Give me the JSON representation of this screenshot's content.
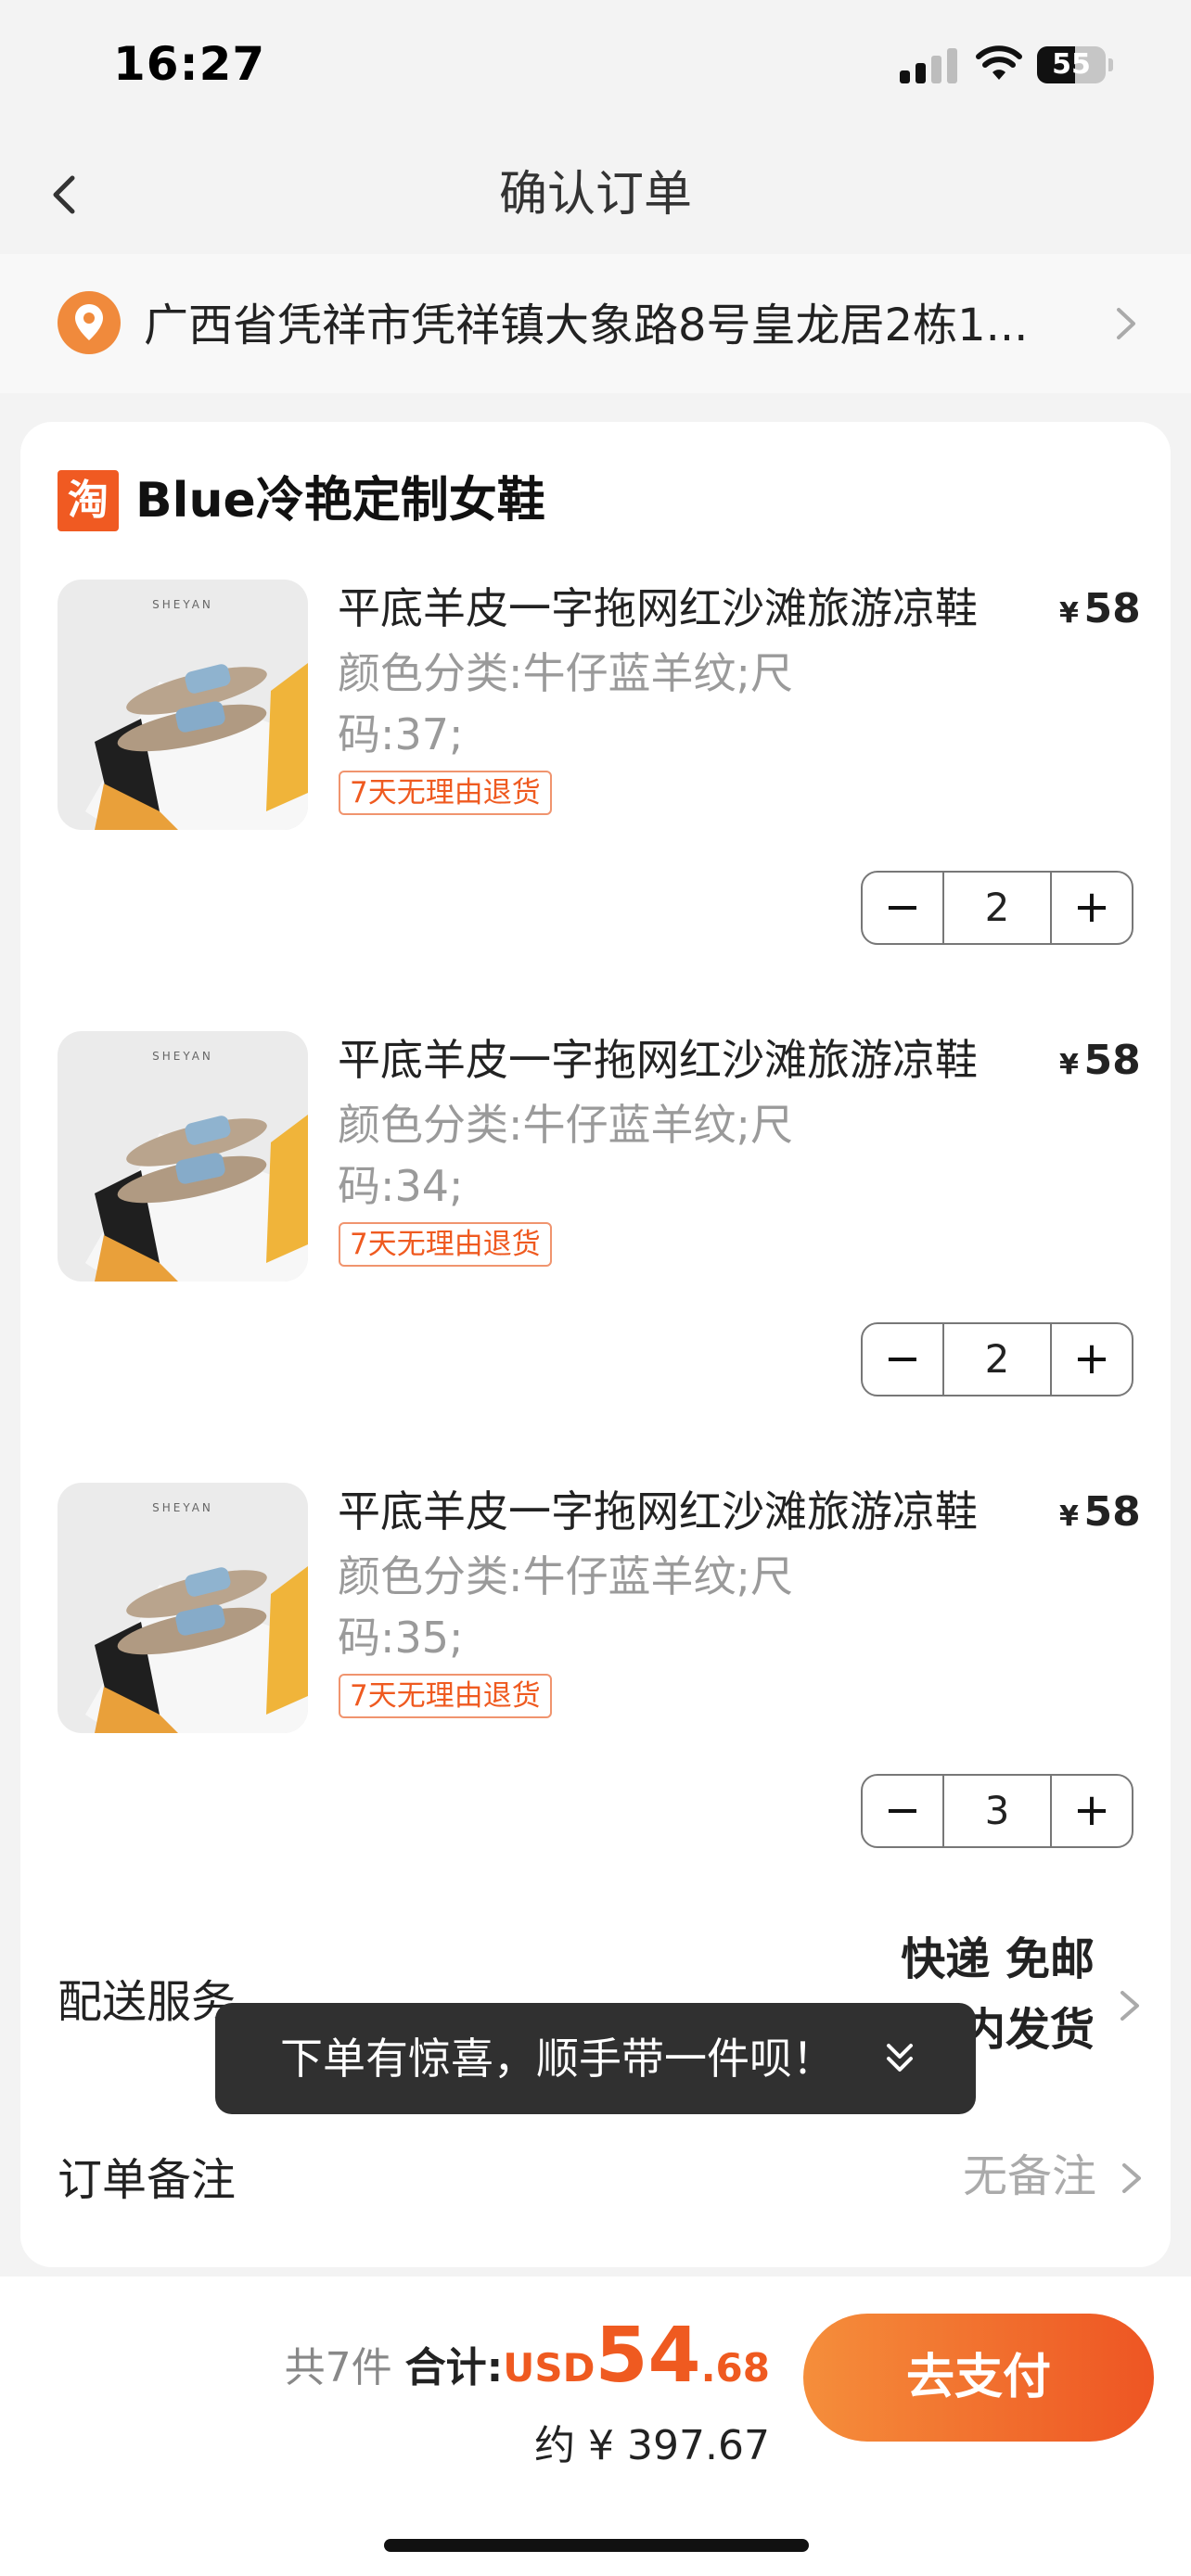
{
  "status_bar": {
    "time": "16:27",
    "battery": "55",
    "battery_level": 0.55
  },
  "nav": {
    "title": "确认订单",
    "back_icon": "chevron-left-icon"
  },
  "address": {
    "text": "广西省凭祥市凭祥镇大象路8号皇龙居2栋1...",
    "icon": "location-pin-icon"
  },
  "shop": {
    "logo_char": "淘",
    "name": "Blue冷艳定制女鞋"
  },
  "items": [
    {
      "brand": "SHEYAN",
      "title": "平底羊皮一字拖网红沙滩旅游凉鞋",
      "currency": "¥",
      "price": "58",
      "spec": "颜色分类:牛仔蓝羊纹;尺码:37;",
      "badge": "7天无理由退货",
      "minus": "−",
      "plus": "+",
      "qty": "2"
    },
    {
      "brand": "SHEYAN",
      "title": "平底羊皮一字拖网红沙滩旅游凉鞋",
      "currency": "¥",
      "price": "58",
      "spec": "颜色分类:牛仔蓝羊纹;尺码:34;",
      "badge": "7天无理由退货",
      "minus": "−",
      "plus": "+",
      "qty": "2"
    },
    {
      "brand": "SHEYAN",
      "title": "平底羊皮一字拖网红沙滩旅游凉鞋",
      "currency": "¥",
      "price": "58",
      "spec": "颜色分类:牛仔蓝羊纹;尺码:35;",
      "badge": "7天无理由退货",
      "minus": "−",
      "plus": "+",
      "qty": "3"
    }
  ],
  "delivery": {
    "label": "配送服务",
    "line1": "快递 免邮",
    "line2": "内发货"
  },
  "note": {
    "label": "订单备注",
    "value": "无备注"
  },
  "toast": {
    "message": "下单有惊喜，顺手带一件呗！"
  },
  "footer": {
    "count": "共7件",
    "total_label": "合计:",
    "currency": "USD",
    "total_int": "54",
    "total_dec": ".68",
    "approx": "约 ¥ 397.67",
    "pay_label": "去支付"
  },
  "colors": {
    "accent": "#ef5a20",
    "pay_gradient_start": "#f58e3b",
    "pay_gradient_end": "#ee5523"
  }
}
